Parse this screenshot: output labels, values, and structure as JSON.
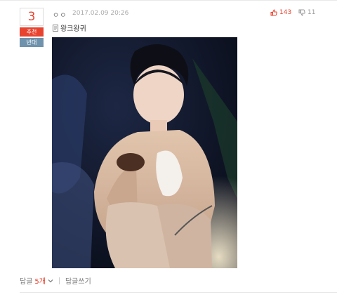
{
  "post": {
    "rank": "3",
    "vote_up_label": "추천",
    "vote_down_label": "반대",
    "author": "ㅇㅇ",
    "datetime": "2017.02.09 20:26",
    "like_count": "143",
    "dislike_count": "11",
    "title": "왕크왕귀"
  },
  "footer": {
    "reply_label": "답글",
    "reply_count": "5개",
    "write_reply_label": "답글쓰기"
  },
  "colors": {
    "accent_red": "#e8432f",
    "downvote_blue": "#6f93ac"
  },
  "icons": [
    "thumbs-up-icon",
    "thumbs-down-icon",
    "document-icon",
    "chevron-down-icon"
  ]
}
